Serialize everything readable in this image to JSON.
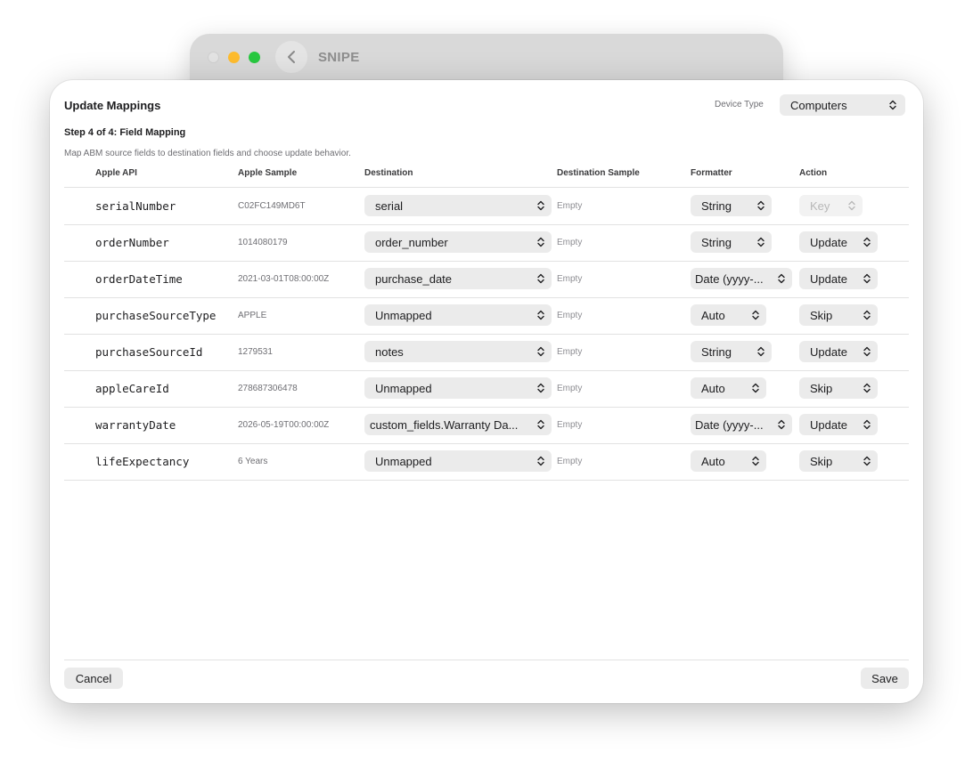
{
  "background_window": {
    "title": "SNIPE"
  },
  "sheet": {
    "title": "Update Mappings",
    "device_type_label": "Device Type",
    "device_type_value": "Computers",
    "step": "Step 4 of 4: Field Mapping",
    "description": "Map ABM source fields to destination fields and choose update behavior.",
    "columns": {
      "api": "Apple API",
      "sample": "Apple Sample",
      "destination": "Destination",
      "dest_sample": "Destination Sample",
      "formatter": "Formatter",
      "action": "Action"
    },
    "rows": [
      {
        "api": "serialNumber",
        "sample": "C02FC149MD6T",
        "destination": "serial",
        "dest_sample": "Empty",
        "formatter": "String",
        "action": "Key"
      },
      {
        "api": "orderNumber",
        "sample": "1014080179",
        "destination": "order_number",
        "dest_sample": "Empty",
        "formatter": "String",
        "action": "Update"
      },
      {
        "api": "orderDateTime",
        "sample": "2021-03-01T08:00:00Z",
        "destination": "purchase_date",
        "dest_sample": "Empty",
        "formatter": "Date (yyyy-...",
        "action": "Update"
      },
      {
        "api": "purchaseSourceType",
        "sample": "APPLE",
        "destination": "Unmapped",
        "dest_sample": "Empty",
        "formatter": "Auto",
        "action": "Skip"
      },
      {
        "api": "purchaseSourceId",
        "sample": "1279531",
        "destination": "notes",
        "dest_sample": "Empty",
        "formatter": "String",
        "action": "Update"
      },
      {
        "api": "appleCareId",
        "sample": "278687306478",
        "destination": "Unmapped",
        "dest_sample": "Empty",
        "formatter": "Auto",
        "action": "Skip"
      },
      {
        "api": "warrantyDate",
        "sample": "2026-05-19T00:00:00Z",
        "destination": "custom_fields.Warranty Da...",
        "dest_sample": "Empty",
        "formatter": "Date (yyyy-...",
        "action": "Update"
      },
      {
        "api": "lifeExpectancy",
        "sample": "6 Years",
        "destination": "Unmapped",
        "dest_sample": "Empty",
        "formatter": "Auto",
        "action": "Skip"
      }
    ],
    "cancel_label": "Cancel",
    "save_label": "Save"
  }
}
